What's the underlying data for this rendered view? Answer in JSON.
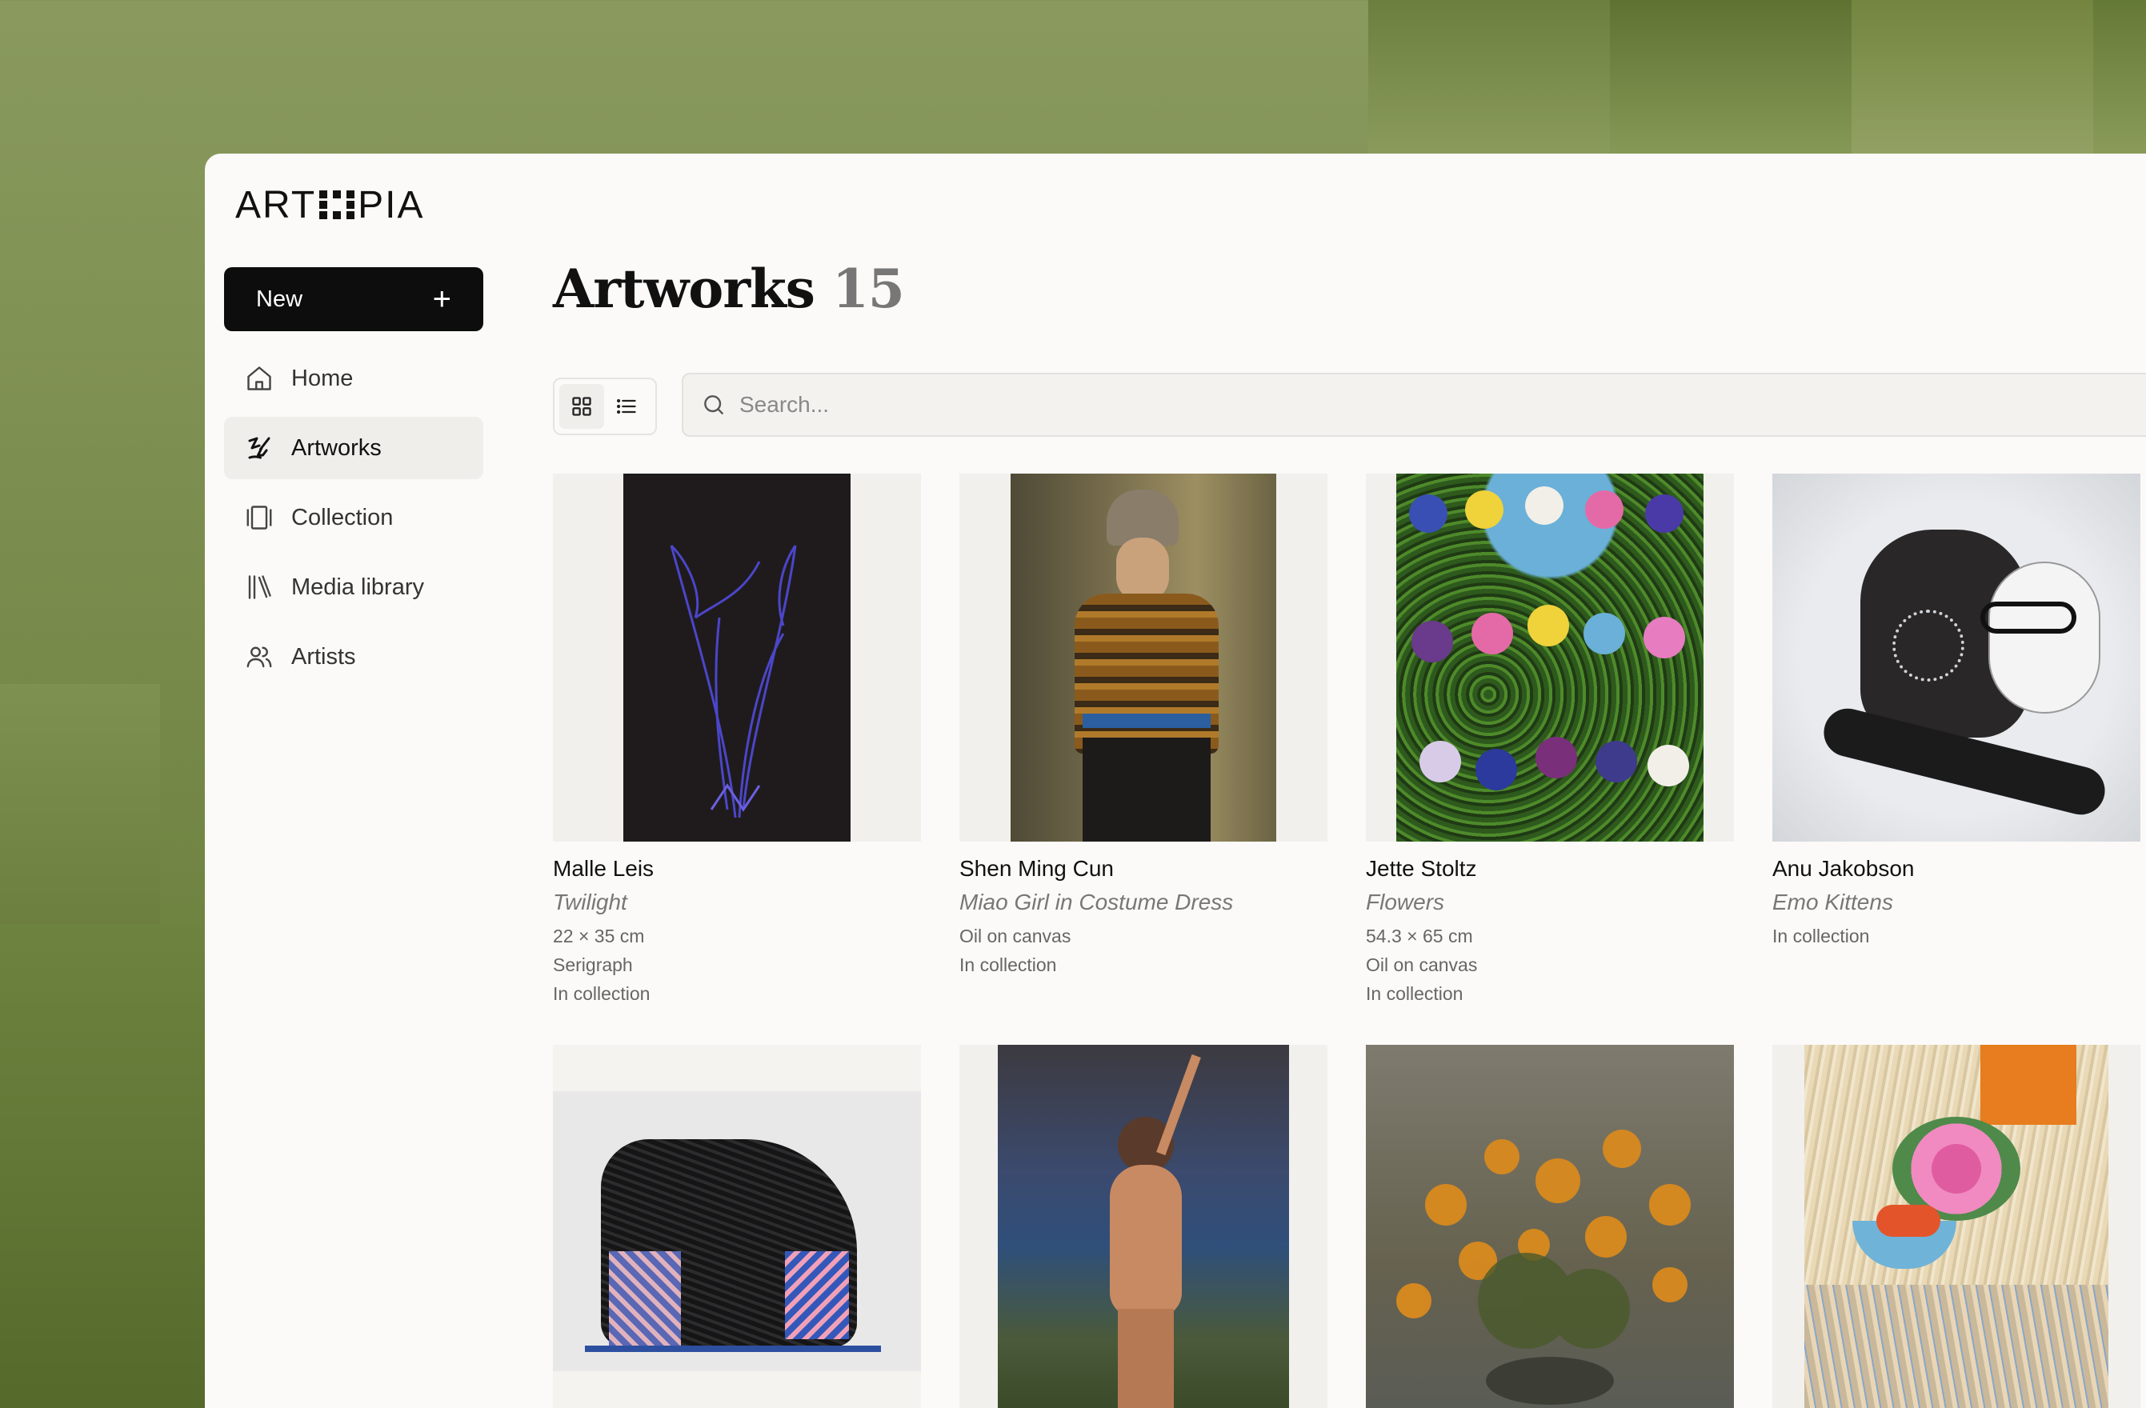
{
  "app": {
    "logo_left": "ART",
    "logo_right": "PIA"
  },
  "sidebar": {
    "new_label": "New",
    "new_icon": "+",
    "items": [
      {
        "label": "Home",
        "icon": "home-icon",
        "active": false
      },
      {
        "label": "Artworks",
        "icon": "artworks-icon",
        "active": true
      },
      {
        "label": "Collection",
        "icon": "collection-icon",
        "active": false
      },
      {
        "label": "Media library",
        "icon": "library-icon",
        "active": false
      },
      {
        "label": "Artists",
        "icon": "users-icon",
        "active": false
      }
    ]
  },
  "main": {
    "title": "Artworks",
    "count": "15",
    "view": {
      "selected": "grid"
    },
    "search": {
      "placeholder": "Search..."
    }
  },
  "artworks": [
    {
      "artist": "Malle Leis",
      "title": "Twilight",
      "size": "22 × 35 cm",
      "medium": "Serigraph",
      "status": "In collection"
    },
    {
      "artist": "Shen Ming Cun",
      "title": "Miao Girl in Costume Dress",
      "medium": "Oil on canvas",
      "status": "In collection"
    },
    {
      "artist": "Jette Stoltz",
      "title": "Flowers",
      "size": "54.3 × 65 cm",
      "medium": "Oil on canvas",
      "status": "In collection"
    },
    {
      "artist": "Anu Jakobson",
      "title": "Emo Kittens",
      "status": "In collection"
    },
    {},
    {},
    {},
    {}
  ]
}
